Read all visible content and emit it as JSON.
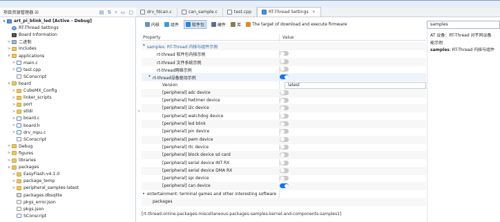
{
  "left_panel": {
    "title": "项目资源管理器 ☒",
    "tools": [
      "▤",
      "⇅",
      "▿",
      "▭",
      "▢"
    ]
  },
  "tabs": [
    {
      "label": "drv_fdcan.c",
      "active": false
    },
    {
      "label": "can_sample.c",
      "active": false
    },
    {
      "label": "test.cpp",
      "active": false
    },
    {
      "label": "RT-Thread Settings",
      "active": true
    }
  ],
  "tree": [
    {
      "label": "art_pi_blink_led    [Active - Debug]",
      "level": 0,
      "arrow": "∨",
      "icon": "proj",
      "bold": true
    },
    {
      "label": "RT-Thread Settings",
      "level": 1,
      "arrow": "",
      "icon": "gear"
    },
    {
      "label": "Board Information",
      "level": 1,
      "arrow": "",
      "icon": "chip"
    },
    {
      "label": "二进制",
      "level": 1,
      "arrow": ">",
      "icon": "binary"
    },
    {
      "label": "Includes",
      "level": 1,
      "arrow": ">",
      "icon": "folder"
    },
    {
      "label": "applications",
      "level": 1,
      "arrow": "∨",
      "icon": "folder"
    },
    {
      "label": "main.c",
      "level": 2,
      "arrow": ">",
      "icon": "filec"
    },
    {
      "label": "test.cpp",
      "level": 2,
      "arrow": ">",
      "icon": "filec"
    },
    {
      "label": "SConscript",
      "level": 2,
      "arrow": "",
      "icon": "file"
    },
    {
      "label": "board",
      "level": 1,
      "arrow": "∨",
      "icon": "folder"
    },
    {
      "label": "CubeMX_Config",
      "level": 2,
      "arrow": ">",
      "icon": "folder"
    },
    {
      "label": "linker_scripts",
      "level": 2,
      "arrow": ">",
      "icon": "folder"
    },
    {
      "label": "port",
      "level": 2,
      "arrow": ">",
      "icon": "folder"
    },
    {
      "label": "stldr",
      "level": 2,
      "arrow": ">",
      "icon": "folder"
    },
    {
      "label": "board.c",
      "level": 2,
      "arrow": ">",
      "icon": "filec"
    },
    {
      "label": "board.h",
      "level": 2,
      "arrow": ">",
      "icon": "filec"
    },
    {
      "label": "drv_mpu.c",
      "level": 2,
      "arrow": ">",
      "icon": "filec"
    },
    {
      "label": "SConscript",
      "level": 2,
      "arrow": "",
      "icon": "file"
    },
    {
      "label": "Debug",
      "level": 1,
      "arrow": ">",
      "icon": "folder"
    },
    {
      "label": "figures",
      "level": 1,
      "arrow": ">",
      "icon": "folder"
    },
    {
      "label": "libraries",
      "level": 1,
      "arrow": ">",
      "icon": "folder"
    },
    {
      "label": "packages",
      "level": 1,
      "arrow": "∨",
      "icon": "folder"
    },
    {
      "label": "EasyFlash-v4.1.0",
      "level": 2,
      "arrow": ">",
      "icon": "folder"
    },
    {
      "label": "package_temp",
      "level": 2,
      "arrow": ">",
      "icon": "folder"
    },
    {
      "label": "peripheral_samples-latest",
      "level": 2,
      "arrow": ">",
      "icon": "folder"
    },
    {
      "label": "packages.dbsqlite",
      "level": 2,
      "arrow": "",
      "icon": "db"
    },
    {
      "label": "pkgs_error.json",
      "level": 2,
      "arrow": "",
      "icon": "json"
    },
    {
      "label": "pkgs.json",
      "level": 2,
      "arrow": "",
      "icon": "json"
    },
    {
      "label": "SConscript",
      "level": 2,
      "arrow": "",
      "icon": "file"
    }
  ],
  "toolbar": [
    {
      "label": "内核",
      "color": "#6b8ec4",
      "active": false
    },
    {
      "label": "组件",
      "color": "#3b9ad9",
      "active": false
    },
    {
      "label": "软件包",
      "color": "#2f80d1",
      "active": true
    },
    {
      "label": "硬件",
      "color": "#5a6f8c",
      "active": false
    },
    {
      "label": "库",
      "color": "#8a7a5c",
      "active": false
    },
    {
      "label": "The target of download and execute firmware",
      "color": "#e08a2e",
      "active": false
    }
  ],
  "search": {
    "value": "samples"
  },
  "table": {
    "col_property": "Property",
    "col_value": "Value",
    "rows": [
      {
        "label": "samples: RT-Thread 内核与组件示例",
        "indent": 8,
        "arrow": "▾",
        "type": "group",
        "blue": true
      },
      {
        "label": "rt-thread 软件包内核示例",
        "indent": 22,
        "arrow": "",
        "type": "toggle",
        "on": false
      },
      {
        "label": "rt-thread 文件系统示例",
        "indent": 22,
        "arrow": "",
        "type": "toggle",
        "on": false
      },
      {
        "label": "rt-thread网络示例",
        "indent": 22,
        "arrow": "",
        "type": "toggle",
        "on": false
      },
      {
        "label": "rt-thread设备驱动示例",
        "indent": 16,
        "arrow": "▾",
        "type": "toggle",
        "on": true
      },
      {
        "label": "Version",
        "indent": 30,
        "arrow": "",
        "type": "value",
        "value": "latest"
      },
      {
        "label": "[peripheral] adc device",
        "indent": 30,
        "arrow": "",
        "type": "toggle",
        "on": false
      },
      {
        "label": "[peripheral] hwtimer device",
        "indent": 30,
        "arrow": "",
        "type": "toggle",
        "on": false
      },
      {
        "label": "[peripheral] i2c device",
        "indent": 30,
        "arrow": "",
        "type": "toggle",
        "on": false
      },
      {
        "label": "[peripheral] watchdog device",
        "indent": 30,
        "arrow": "",
        "type": "toggle",
        "on": false
      },
      {
        "label": "[peripheral] led blink",
        "indent": 30,
        "arrow": "",
        "type": "toggle",
        "on": false
      },
      {
        "label": "[peripheral] pin device",
        "indent": 30,
        "arrow": "",
        "type": "toggle",
        "on": false
      },
      {
        "label": "[peripheral] pwm device",
        "indent": 30,
        "arrow": "",
        "type": "toggle",
        "on": false
      },
      {
        "label": "[peripheral] rtc device",
        "indent": 30,
        "arrow": "",
        "type": "toggle",
        "on": false
      },
      {
        "label": "[peripheral] block device sd card",
        "indent": 30,
        "arrow": "",
        "type": "toggle",
        "on": false
      },
      {
        "label": "[peripheral] serial device INT RX",
        "indent": 30,
        "arrow": "",
        "type": "toggle",
        "on": false
      },
      {
        "label": "[peripheral] serial device DMA RX",
        "indent": 30,
        "arrow": "",
        "type": "toggle",
        "on": false
      },
      {
        "label": "[peripheral] spi device",
        "indent": 30,
        "arrow": "",
        "type": "toggle",
        "on": false
      },
      {
        "label": "[peripheral] can device",
        "indent": 30,
        "arrow": "",
        "type": "toggle",
        "on": true
      },
      {
        "label": "entertainment: terminal games and other interesting software",
        "indent": 8,
        "arrow": "▸",
        "type": "group",
        "blue": false
      },
      {
        "label": "packages",
        "indent": 16,
        "arrow": "",
        "type": "plain"
      }
    ]
  },
  "path": "[rt-thread-online-packages-miscellaneous-packages-samples-kernel-and-components-samples1]",
  "description": {
    "line1": "AT 设备：RT-Thread 对不同设备",
    "line2": "能示例",
    "line3_bold": "samples",
    "line3_rest": ": RT-Thread 内核与组件"
  },
  "sash_glyph": "»"
}
